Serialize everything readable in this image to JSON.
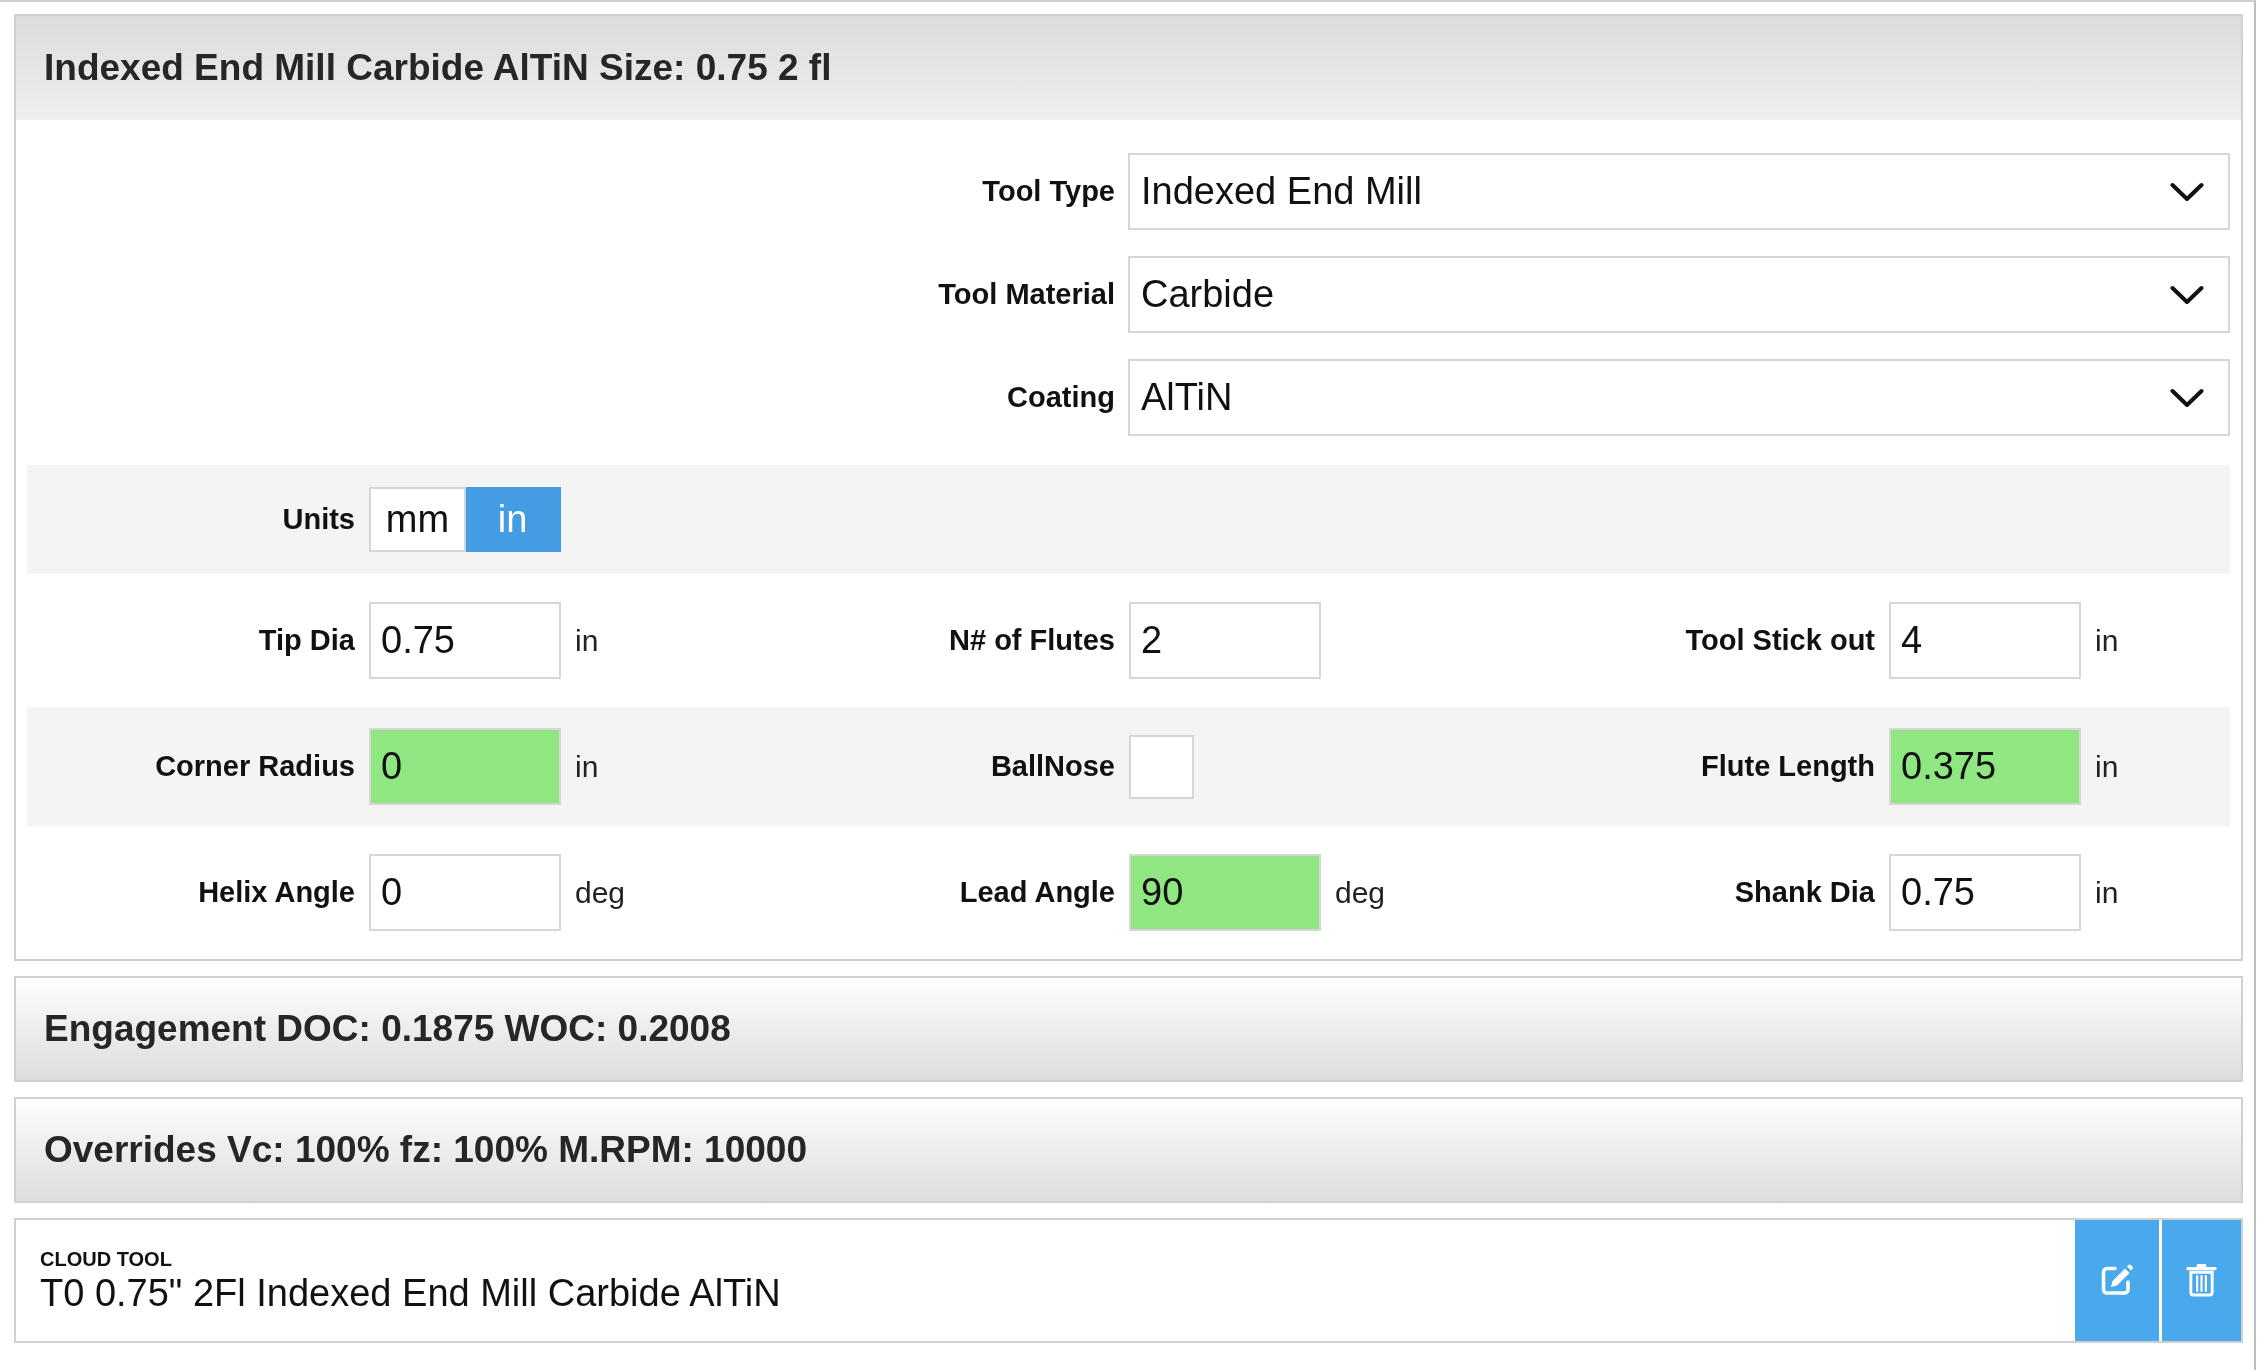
{
  "tool_panel": {
    "title": "Indexed End Mill Carbide AlTiN Size: 0.75 2 fl",
    "selects": [
      {
        "label": "Tool Type",
        "value": "Indexed End Mill"
      },
      {
        "label": "Tool Material",
        "value": "Carbide"
      },
      {
        "label": "Coating",
        "value": "AlTiN"
      }
    ],
    "units": {
      "label": "Units",
      "options": [
        {
          "label": "mm",
          "selected": false
        },
        {
          "label": "in",
          "selected": true
        }
      ]
    },
    "field_rows": [
      {
        "fields": [
          {
            "kind": "number",
            "label": "Tip Dia",
            "value": "0.75",
            "unit": "in",
            "highlighted": false
          },
          {
            "kind": "number",
            "label": "N# of Flutes",
            "value": "2",
            "highlighted": false
          },
          {
            "kind": "number",
            "label": "Tool Stick out",
            "value": "4",
            "unit": "in",
            "highlighted": false
          }
        ]
      },
      {
        "fields": [
          {
            "kind": "number",
            "label": "Corner Radius",
            "value": "0",
            "unit": "in",
            "highlighted": true
          },
          {
            "kind": "checkbox",
            "label": "BallNose",
            "checked": false
          },
          {
            "kind": "number",
            "label": "Flute Length",
            "value": "0.375",
            "unit": "in",
            "highlighted": true
          }
        ]
      },
      {
        "fields": [
          {
            "kind": "number",
            "label": "Helix Angle",
            "value": "0",
            "unit": "deg",
            "highlighted": false
          },
          {
            "kind": "number",
            "label": "Lead Angle",
            "value": "90",
            "unit": "deg",
            "highlighted": true
          },
          {
            "kind": "number",
            "label": "Shank Dia",
            "value": "0.75",
            "unit": "in",
            "highlighted": false
          }
        ]
      }
    ]
  },
  "collapsed_panels": [
    {
      "title": "Engagement DOC: 0.1875 WOC: 0.2008"
    },
    {
      "title": "Overrides Vc: 100% fz: 100% M.RPM: 10000"
    }
  ],
  "cloud_tool": {
    "source": "CLOUD TOOL",
    "name": "T0 0.75\" 2Fl Indexed End Mill Carbide AlTiN"
  }
}
